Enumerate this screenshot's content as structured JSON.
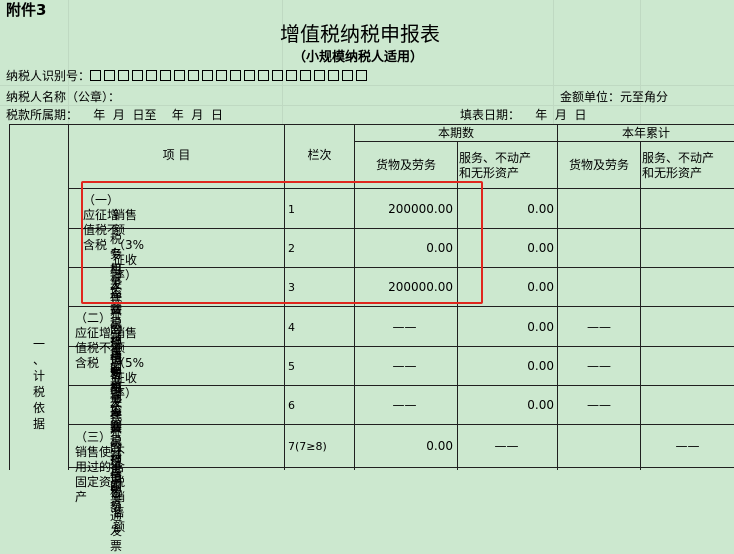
{
  "attachment_label": "附件3",
  "form": {
    "title": "增值税纳税申报表",
    "subtitle": "（小规模纳税人适用）",
    "taxpayer_id_label": "纳税人识别号：",
    "taxpayer_id_boxes": 20,
    "taxpayer_name_label": "纳税人名称（公章）：",
    "amount_unit": "金额单位：元至角分",
    "tax_period": "税款所属期：    年  月  日至    年  月  日",
    "fill_date": "填表日期：    年  月  日"
  },
  "table": {
    "header": {
      "item": "项    目",
      "column_no": "栏次",
      "current_period": "本期数",
      "year_cumulative": "本年累计",
      "goods_labor": "货物及劳务",
      "services_line1": "服务、不动产",
      "services_line2": "和无形资产"
    },
    "section_label": "一、计税依据",
    "rows": [
      {
        "item_line1": "（一）应征增值税不含税",
        "item_line2": "销售额（3%征收率）",
        "no": "1",
        "goods": "200000.00",
        "services": "0.00",
        "ytd_goods": "",
        "ytd_services": ""
      },
      {
        "item_line1": "税务机关代开的增值税",
        "item_line2": "专用发票不含税销售额",
        "no": "2",
        "goods": "0.00",
        "services": "0.00",
        "ytd_goods": "",
        "ytd_services": ""
      },
      {
        "item_line1": "税控器具开具的普通发票",
        "item_line2": "不含税销售额",
        "no": "3",
        "goods": "200000.00",
        "services": "0.00",
        "ytd_goods": "",
        "ytd_services": ""
      },
      {
        "item_line1": "（二）应征增值税不含税",
        "item_line2": "销售额（5%征收率）",
        "no": "4",
        "goods": "——",
        "services": "0.00",
        "ytd_goods": "——",
        "ytd_services": ""
      },
      {
        "item_line1": "税务机关代开的增值税",
        "item_line2": "专用发票不含税销售额",
        "no": "5",
        "goods": "——",
        "services": "0.00",
        "ytd_goods": "——",
        "ytd_services": ""
      },
      {
        "item_line1": "税控器具开具的普通发票",
        "item_line2": "不含税销售额",
        "no": "6",
        "goods": "——",
        "services": "0.00",
        "ytd_goods": "——",
        "ytd_services": ""
      },
      {
        "item_line1": "（三）销售使用过的固定资产",
        "item_line2": "不含税销售额",
        "no": "7(7≥8)",
        "goods": "0.00",
        "services": "——",
        "ytd_goods": "",
        "ytd_services": "——"
      }
    ]
  }
}
